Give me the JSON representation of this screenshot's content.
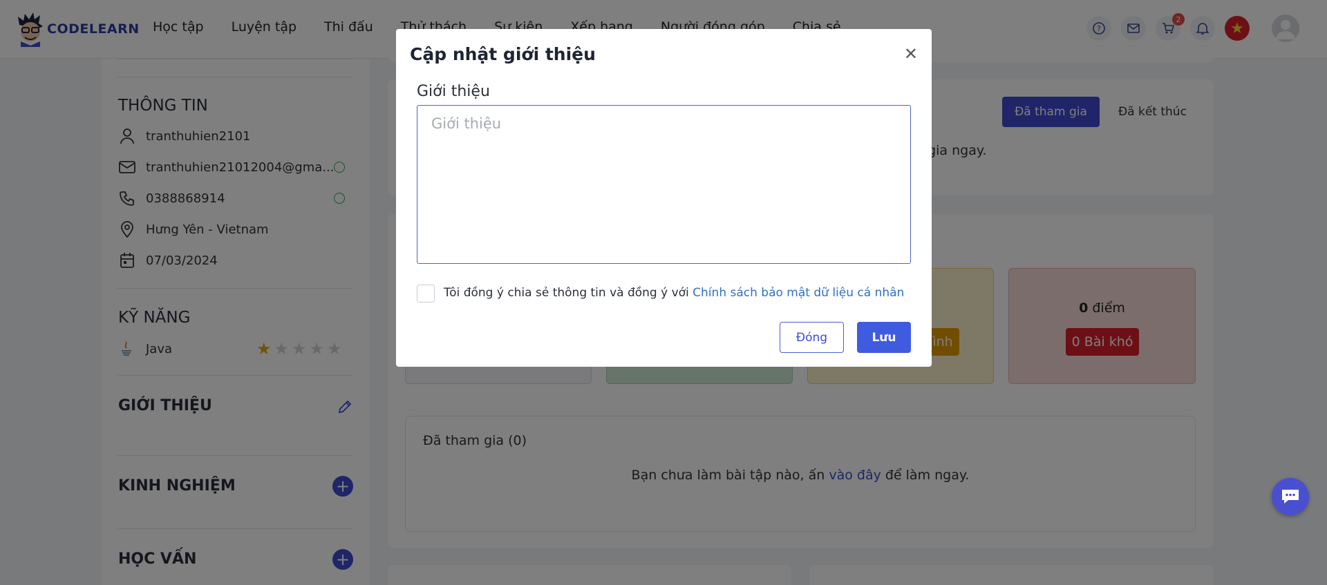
{
  "brand": {
    "name": "CODELEARN"
  },
  "nav": [
    "Học tập",
    "Luyện tập",
    "Thi đấu",
    "Thử thách",
    "Sự kiện",
    "Xếp hạng",
    "Người đóng góp",
    "Chia sẻ"
  ],
  "header": {
    "cart_count": "2"
  },
  "sidebar": {
    "info_title": "THÔNG TIN",
    "username": "tranthuhien2101",
    "email": "tranthuhien21012004@gma...",
    "phone": "0388868914",
    "location": "Hưng Yên - Vietnam",
    "date": "07/03/2024",
    "skills_title": "KỸ NĂNG",
    "skill": "Java",
    "skill_rating": 1,
    "intro_title": "GIỚI THIỆU",
    "experience_title": "KINH NGHIỆM",
    "education_title": "HỌC VẤN"
  },
  "content": {
    "tab_joined": "Đã tham gia",
    "tab_ended": "Đã kết thúc",
    "top_msg_fragment": "n gia ngay.",
    "stat_points": "0 điểm",
    "stat_points_num": "0",
    "stat_points_unit": " điểm",
    "stat_hard_pill": "0 Bài khó",
    "stat_medium_fragment": "ình",
    "joined_title": "Đã tham gia (0)",
    "empty_msg_pre": "Bạn chưa làm bài tập nào, ấn ",
    "empty_msg_link": "vào đây",
    "empty_msg_post": " để làm ngay."
  },
  "modal": {
    "title": "Cập nhật giới thiệu",
    "field_label": "Giới thiệu",
    "field_value": "",
    "field_placeholder": "Giới thiệu",
    "consent_text": "Tôi đồng ý chia sẻ thông tin và đồng ý với ",
    "consent_link": "Chính sách bảo mật dữ liệu cá nhân",
    "close_label": "Đóng",
    "save_label": "Lưu"
  },
  "colors": {
    "primary": "#3f4bd1",
    "link": "#2f70c4",
    "danger": "#d8202c",
    "success": "#2fa94e"
  }
}
